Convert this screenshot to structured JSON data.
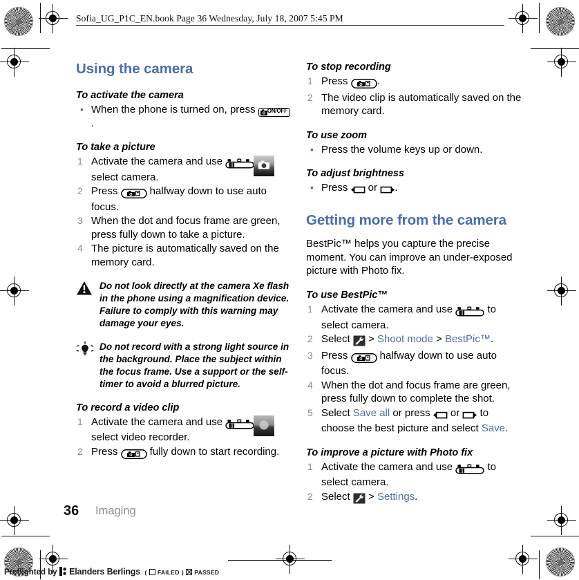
{
  "header": {
    "text": "Sofia_UG_P1C_EN.book  Page 36  Wednesday, July 18, 2007  5:45 PM"
  },
  "left_column": {
    "section_title": "Using the camera",
    "blocks": [
      {
        "heading": "To activate the camera",
        "bullets": [
          {
            "pre": "When the phone is turned on, press ",
            "key": "camera-onoff-key",
            "key_label": "ON/OFF",
            "post": "."
          }
        ]
      },
      {
        "heading": "To take a picture",
        "steps": [
          {
            "num": "1",
            "pre": "Activate the camera and use ",
            "key": "navigation-key",
            "post": " to select camera."
          },
          {
            "num": "2",
            "pre": "Press ",
            "key": "camera-shutter-key",
            "post": " halfway down to use auto focus."
          },
          {
            "num": "3",
            "text": "When the dot and focus frame are green, press fully down to take a picture."
          },
          {
            "num": "4",
            "text": "The picture is automatically saved on the memory card."
          }
        ],
        "thumbnail": "camera-thumbnail"
      },
      {
        "note_type": "warning",
        "icon": "warning-triangle-icon",
        "text": "Do not look directly at the camera Xe flash in the phone using a magnification device. Failure to comply with this warning may damage your eyes."
      },
      {
        "note_type": "tip",
        "icon": "lightbulb-icon",
        "text": "Do not record with a strong light source in the background. Place the subject within the focus frame. Use a support or the self-timer to avoid a blurred picture."
      },
      {
        "heading": "To record a video clip",
        "steps": [
          {
            "num": "1",
            "pre": "Activate the camera and use ",
            "key": "navigation-key",
            "post": " to select video recorder."
          },
          {
            "num": "2",
            "pre": "Press ",
            "key": "camera-shutter-key",
            "post": " fully down to start recording."
          }
        ],
        "thumbnail": "video-recorder-thumbnail"
      }
    ]
  },
  "right_column": {
    "blocks": [
      {
        "heading": "To stop recording",
        "steps": [
          {
            "num": "1",
            "pre": "Press ",
            "key": "camera-shutter-key",
            "post": "."
          },
          {
            "num": "2",
            "text": "The video clip is automatically saved on the memory card."
          }
        ]
      },
      {
        "heading": "To use zoom",
        "bullets": [
          {
            "text": "Press the volume keys up or down."
          }
        ]
      },
      {
        "heading": "To adjust brightness",
        "bullets": [
          {
            "pre": "Press ",
            "key": "left-selection-key",
            "mid": " or ",
            "key2": "right-selection-key",
            "post": "."
          }
        ]
      }
    ],
    "section_title": "Getting more from the camera",
    "intro": "BestPic™ helps you capture the precise moment. You can improve an under-exposed picture with Photo fix.",
    "blocks2": [
      {
        "heading": "To use BestPic™",
        "steps": [
          {
            "num": "1",
            "pre": "Activate the camera and use ",
            "key": "navigation-key",
            "post": " to select camera."
          },
          {
            "num": "2",
            "pre": "Select ",
            "key": "settings-wrench-icon",
            "mid": " > ",
            "link1": "Shoot mode",
            "mid2": " > ",
            "link2": "BestPic™",
            "post": "."
          },
          {
            "num": "3",
            "pre": "Press ",
            "key": "camera-shutter-key",
            "post": " halfway down to use auto focus."
          },
          {
            "num": "4",
            "text": "When the dot and focus frame are green, press fully down to complete the shot."
          },
          {
            "num": "5",
            "pre": "Select ",
            "link1": "Save all",
            "mid": " or press ",
            "key": "left-selection-key",
            "mid2": " or ",
            "key2": "right-selection-key",
            "mid3": " to choose the best picture and select ",
            "link2": "Save",
            "post": "."
          }
        ]
      },
      {
        "heading": "To improve a picture with Photo fix",
        "steps": [
          {
            "num": "1",
            "pre": "Activate the camera and use ",
            "key": "navigation-key",
            "post": " to select camera."
          },
          {
            "num": "2",
            "pre": "Select ",
            "key": "settings-wrench-icon",
            "mid": " > ",
            "link1": "Settings",
            "post": "."
          }
        ]
      }
    ]
  },
  "footer": {
    "page_number": "36",
    "chapter": "Imaging"
  },
  "preflight": {
    "prefix": "Preflighted by",
    "company": "Elanders Berlings",
    "open_paren": "(",
    "failed_label": "FAILED",
    "close_paren": ")",
    "passed_label": "PASSED"
  },
  "colors": {
    "heading_blue": "#4a6fa8",
    "link_blue": "#4a6fa8",
    "step_number_gray": "#8a8a8a",
    "chapter_gray": "#8e8e8e"
  }
}
